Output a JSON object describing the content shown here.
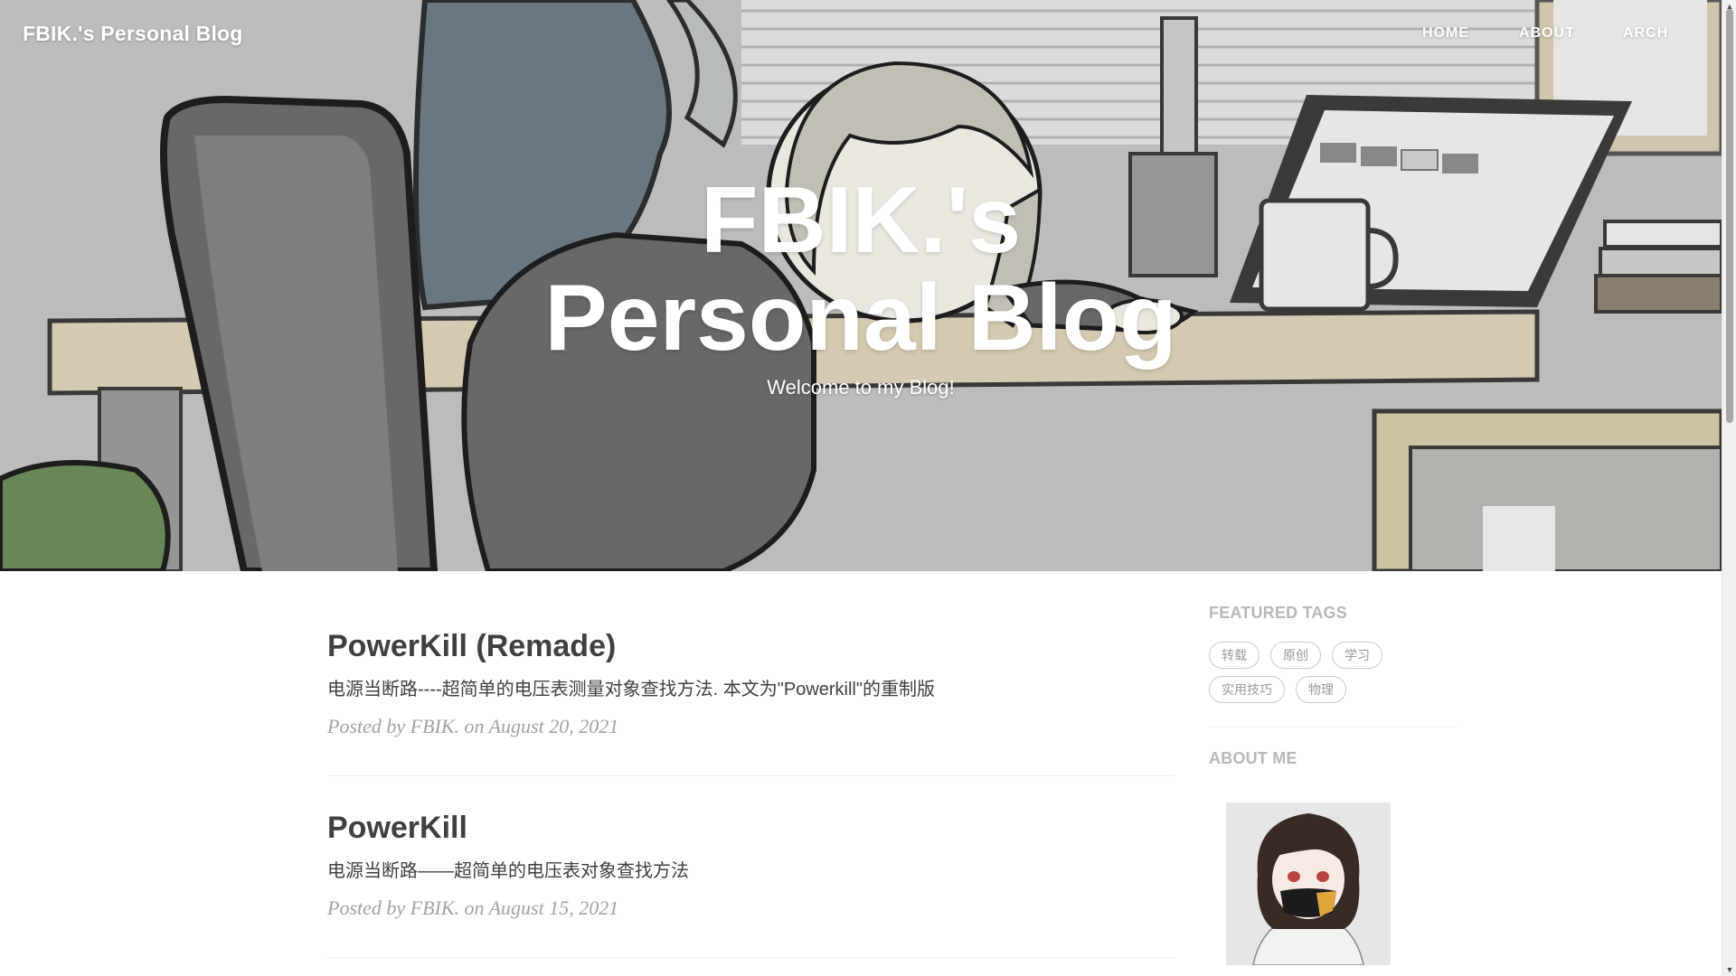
{
  "navbar": {
    "brand": "FBIK.'s Personal Blog",
    "links": [
      "HOME",
      "ABOUT",
      "ARCH"
    ]
  },
  "hero": {
    "title": "FBIK.'s Personal Blog",
    "subtitle": "Welcome to my Blog!"
  },
  "posts": [
    {
      "title": "PowerKill (Remade)",
      "excerpt": "电源当断路----超简单的电压表测量对象查找方法. 本文为\"Powerkill\"的重制版",
      "meta": "Posted by FBIK. on August 20, 2021"
    },
    {
      "title": "PowerKill",
      "excerpt": "电源当断路——超简单的电压表对象查找方法",
      "meta": "Posted by FBIK. on August 15, 2021"
    }
  ],
  "sidebar": {
    "featured_tags_heading": "FEATURED TAGS",
    "tags": [
      "转载",
      "原创",
      "学习",
      "实用技巧",
      "物理"
    ],
    "about_heading": "ABOUT ME"
  },
  "colors": {
    "text": "#404040",
    "meta": "#a3a3a3",
    "sidebar_heading": "#b8b8b8",
    "tag_border": "#c9c9c9"
  }
}
